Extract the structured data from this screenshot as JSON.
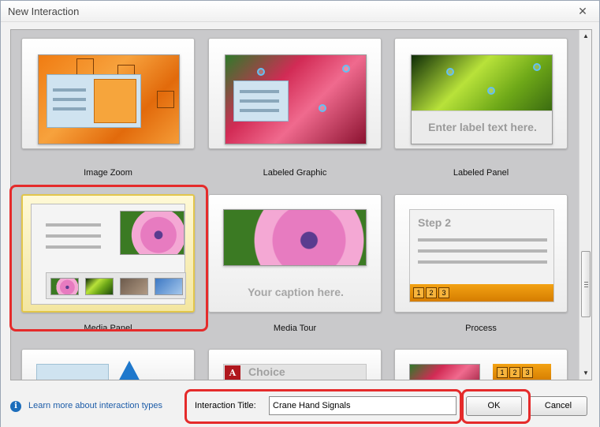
{
  "window": {
    "title": "New Interaction",
    "close_glyph": "✕"
  },
  "gallery": {
    "cards": [
      {
        "label": "Image Zoom"
      },
      {
        "label": "Labeled Graphic"
      },
      {
        "label": "Labeled Panel",
        "placeholder_text": "Enter label text here."
      },
      {
        "label": "Media Panel",
        "selected": true
      },
      {
        "label": "Media Tour",
        "caption_text": "Your caption here."
      },
      {
        "label": "Process",
        "step_title": "Step 2",
        "step_numbers": [
          "1",
          "2",
          "3"
        ]
      }
    ],
    "partial_cards": [
      {
        "label": ""
      },
      {
        "label": "",
        "choice_text": "Choice"
      },
      {
        "label": "",
        "step_numbers": [
          "1",
          "2",
          "3"
        ]
      }
    ]
  },
  "footer": {
    "info_icon": "i",
    "learn_more_link": "Learn more about interaction types",
    "title_label": "Interaction Title:",
    "title_value": "Crane Hand Signals",
    "ok_label": "OK",
    "cancel_label": "Cancel"
  },
  "colors": {
    "selection_highlight": "#e52b2b",
    "selected_card_border": "#e2c64b",
    "link": "#1c5ca8"
  }
}
